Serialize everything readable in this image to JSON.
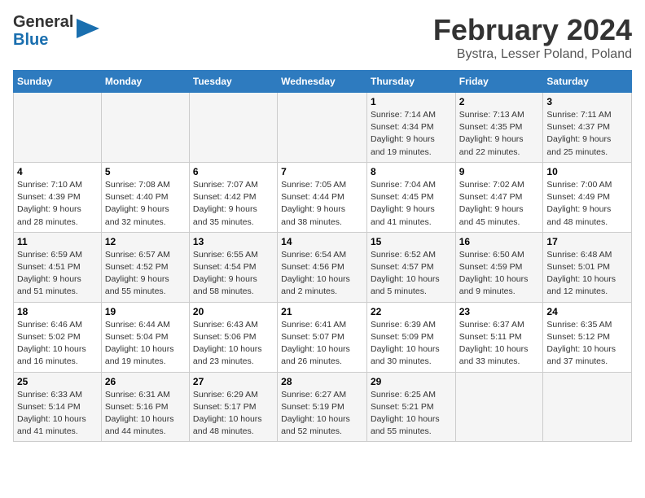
{
  "header": {
    "logo_line1": "General",
    "logo_line2": "Blue",
    "title": "February 2024",
    "subtitle": "Bystra, Lesser Poland, Poland"
  },
  "columns": [
    "Sunday",
    "Monday",
    "Tuesday",
    "Wednesday",
    "Thursday",
    "Friday",
    "Saturday"
  ],
  "weeks": [
    {
      "days": [
        {
          "num": "",
          "info": ""
        },
        {
          "num": "",
          "info": ""
        },
        {
          "num": "",
          "info": ""
        },
        {
          "num": "",
          "info": ""
        },
        {
          "num": "1",
          "info": "Sunrise: 7:14 AM\nSunset: 4:34 PM\nDaylight: 9 hours\nand 19 minutes."
        },
        {
          "num": "2",
          "info": "Sunrise: 7:13 AM\nSunset: 4:35 PM\nDaylight: 9 hours\nand 22 minutes."
        },
        {
          "num": "3",
          "info": "Sunrise: 7:11 AM\nSunset: 4:37 PM\nDaylight: 9 hours\nand 25 minutes."
        }
      ]
    },
    {
      "days": [
        {
          "num": "4",
          "info": "Sunrise: 7:10 AM\nSunset: 4:39 PM\nDaylight: 9 hours\nand 28 minutes."
        },
        {
          "num": "5",
          "info": "Sunrise: 7:08 AM\nSunset: 4:40 PM\nDaylight: 9 hours\nand 32 minutes."
        },
        {
          "num": "6",
          "info": "Sunrise: 7:07 AM\nSunset: 4:42 PM\nDaylight: 9 hours\nand 35 minutes."
        },
        {
          "num": "7",
          "info": "Sunrise: 7:05 AM\nSunset: 4:44 PM\nDaylight: 9 hours\nand 38 minutes."
        },
        {
          "num": "8",
          "info": "Sunrise: 7:04 AM\nSunset: 4:45 PM\nDaylight: 9 hours\nand 41 minutes."
        },
        {
          "num": "9",
          "info": "Sunrise: 7:02 AM\nSunset: 4:47 PM\nDaylight: 9 hours\nand 45 minutes."
        },
        {
          "num": "10",
          "info": "Sunrise: 7:00 AM\nSunset: 4:49 PM\nDaylight: 9 hours\nand 48 minutes."
        }
      ]
    },
    {
      "days": [
        {
          "num": "11",
          "info": "Sunrise: 6:59 AM\nSunset: 4:51 PM\nDaylight: 9 hours\nand 51 minutes."
        },
        {
          "num": "12",
          "info": "Sunrise: 6:57 AM\nSunset: 4:52 PM\nDaylight: 9 hours\nand 55 minutes."
        },
        {
          "num": "13",
          "info": "Sunrise: 6:55 AM\nSunset: 4:54 PM\nDaylight: 9 hours\nand 58 minutes."
        },
        {
          "num": "14",
          "info": "Sunrise: 6:54 AM\nSunset: 4:56 PM\nDaylight: 10 hours\nand 2 minutes."
        },
        {
          "num": "15",
          "info": "Sunrise: 6:52 AM\nSunset: 4:57 PM\nDaylight: 10 hours\nand 5 minutes."
        },
        {
          "num": "16",
          "info": "Sunrise: 6:50 AM\nSunset: 4:59 PM\nDaylight: 10 hours\nand 9 minutes."
        },
        {
          "num": "17",
          "info": "Sunrise: 6:48 AM\nSunset: 5:01 PM\nDaylight: 10 hours\nand 12 minutes."
        }
      ]
    },
    {
      "days": [
        {
          "num": "18",
          "info": "Sunrise: 6:46 AM\nSunset: 5:02 PM\nDaylight: 10 hours\nand 16 minutes."
        },
        {
          "num": "19",
          "info": "Sunrise: 6:44 AM\nSunset: 5:04 PM\nDaylight: 10 hours\nand 19 minutes."
        },
        {
          "num": "20",
          "info": "Sunrise: 6:43 AM\nSunset: 5:06 PM\nDaylight: 10 hours\nand 23 minutes."
        },
        {
          "num": "21",
          "info": "Sunrise: 6:41 AM\nSunset: 5:07 PM\nDaylight: 10 hours\nand 26 minutes."
        },
        {
          "num": "22",
          "info": "Sunrise: 6:39 AM\nSunset: 5:09 PM\nDaylight: 10 hours\nand 30 minutes."
        },
        {
          "num": "23",
          "info": "Sunrise: 6:37 AM\nSunset: 5:11 PM\nDaylight: 10 hours\nand 33 minutes."
        },
        {
          "num": "24",
          "info": "Sunrise: 6:35 AM\nSunset: 5:12 PM\nDaylight: 10 hours\nand 37 minutes."
        }
      ]
    },
    {
      "days": [
        {
          "num": "25",
          "info": "Sunrise: 6:33 AM\nSunset: 5:14 PM\nDaylight: 10 hours\nand 41 minutes."
        },
        {
          "num": "26",
          "info": "Sunrise: 6:31 AM\nSunset: 5:16 PM\nDaylight: 10 hours\nand 44 minutes."
        },
        {
          "num": "27",
          "info": "Sunrise: 6:29 AM\nSunset: 5:17 PM\nDaylight: 10 hours\nand 48 minutes."
        },
        {
          "num": "28",
          "info": "Sunrise: 6:27 AM\nSunset: 5:19 PM\nDaylight: 10 hours\nand 52 minutes."
        },
        {
          "num": "29",
          "info": "Sunrise: 6:25 AM\nSunset: 5:21 PM\nDaylight: 10 hours\nand 55 minutes."
        },
        {
          "num": "",
          "info": ""
        },
        {
          "num": "",
          "info": ""
        }
      ]
    }
  ]
}
